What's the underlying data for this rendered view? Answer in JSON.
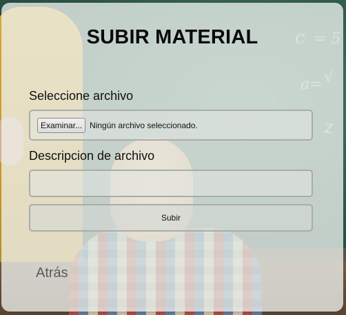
{
  "form": {
    "title": "SUBIR MATERIAL",
    "file_label": "Seleccione archivo",
    "browse_button": "Examinar...",
    "file_status": "Ningún archivo seleccionado.",
    "description_label": "Descripcion de archivo",
    "description_value": "",
    "description_placeholder": "",
    "submit_label": "Subir",
    "back_link": "Atrás"
  },
  "background": {
    "chalk_marks": [
      "c",
      "= 5",
      "a=",
      "√",
      "z"
    ]
  },
  "colors": {
    "card": "#e8ece8",
    "field_border": "#a9aca9",
    "back_link": "#5a5a5a"
  }
}
